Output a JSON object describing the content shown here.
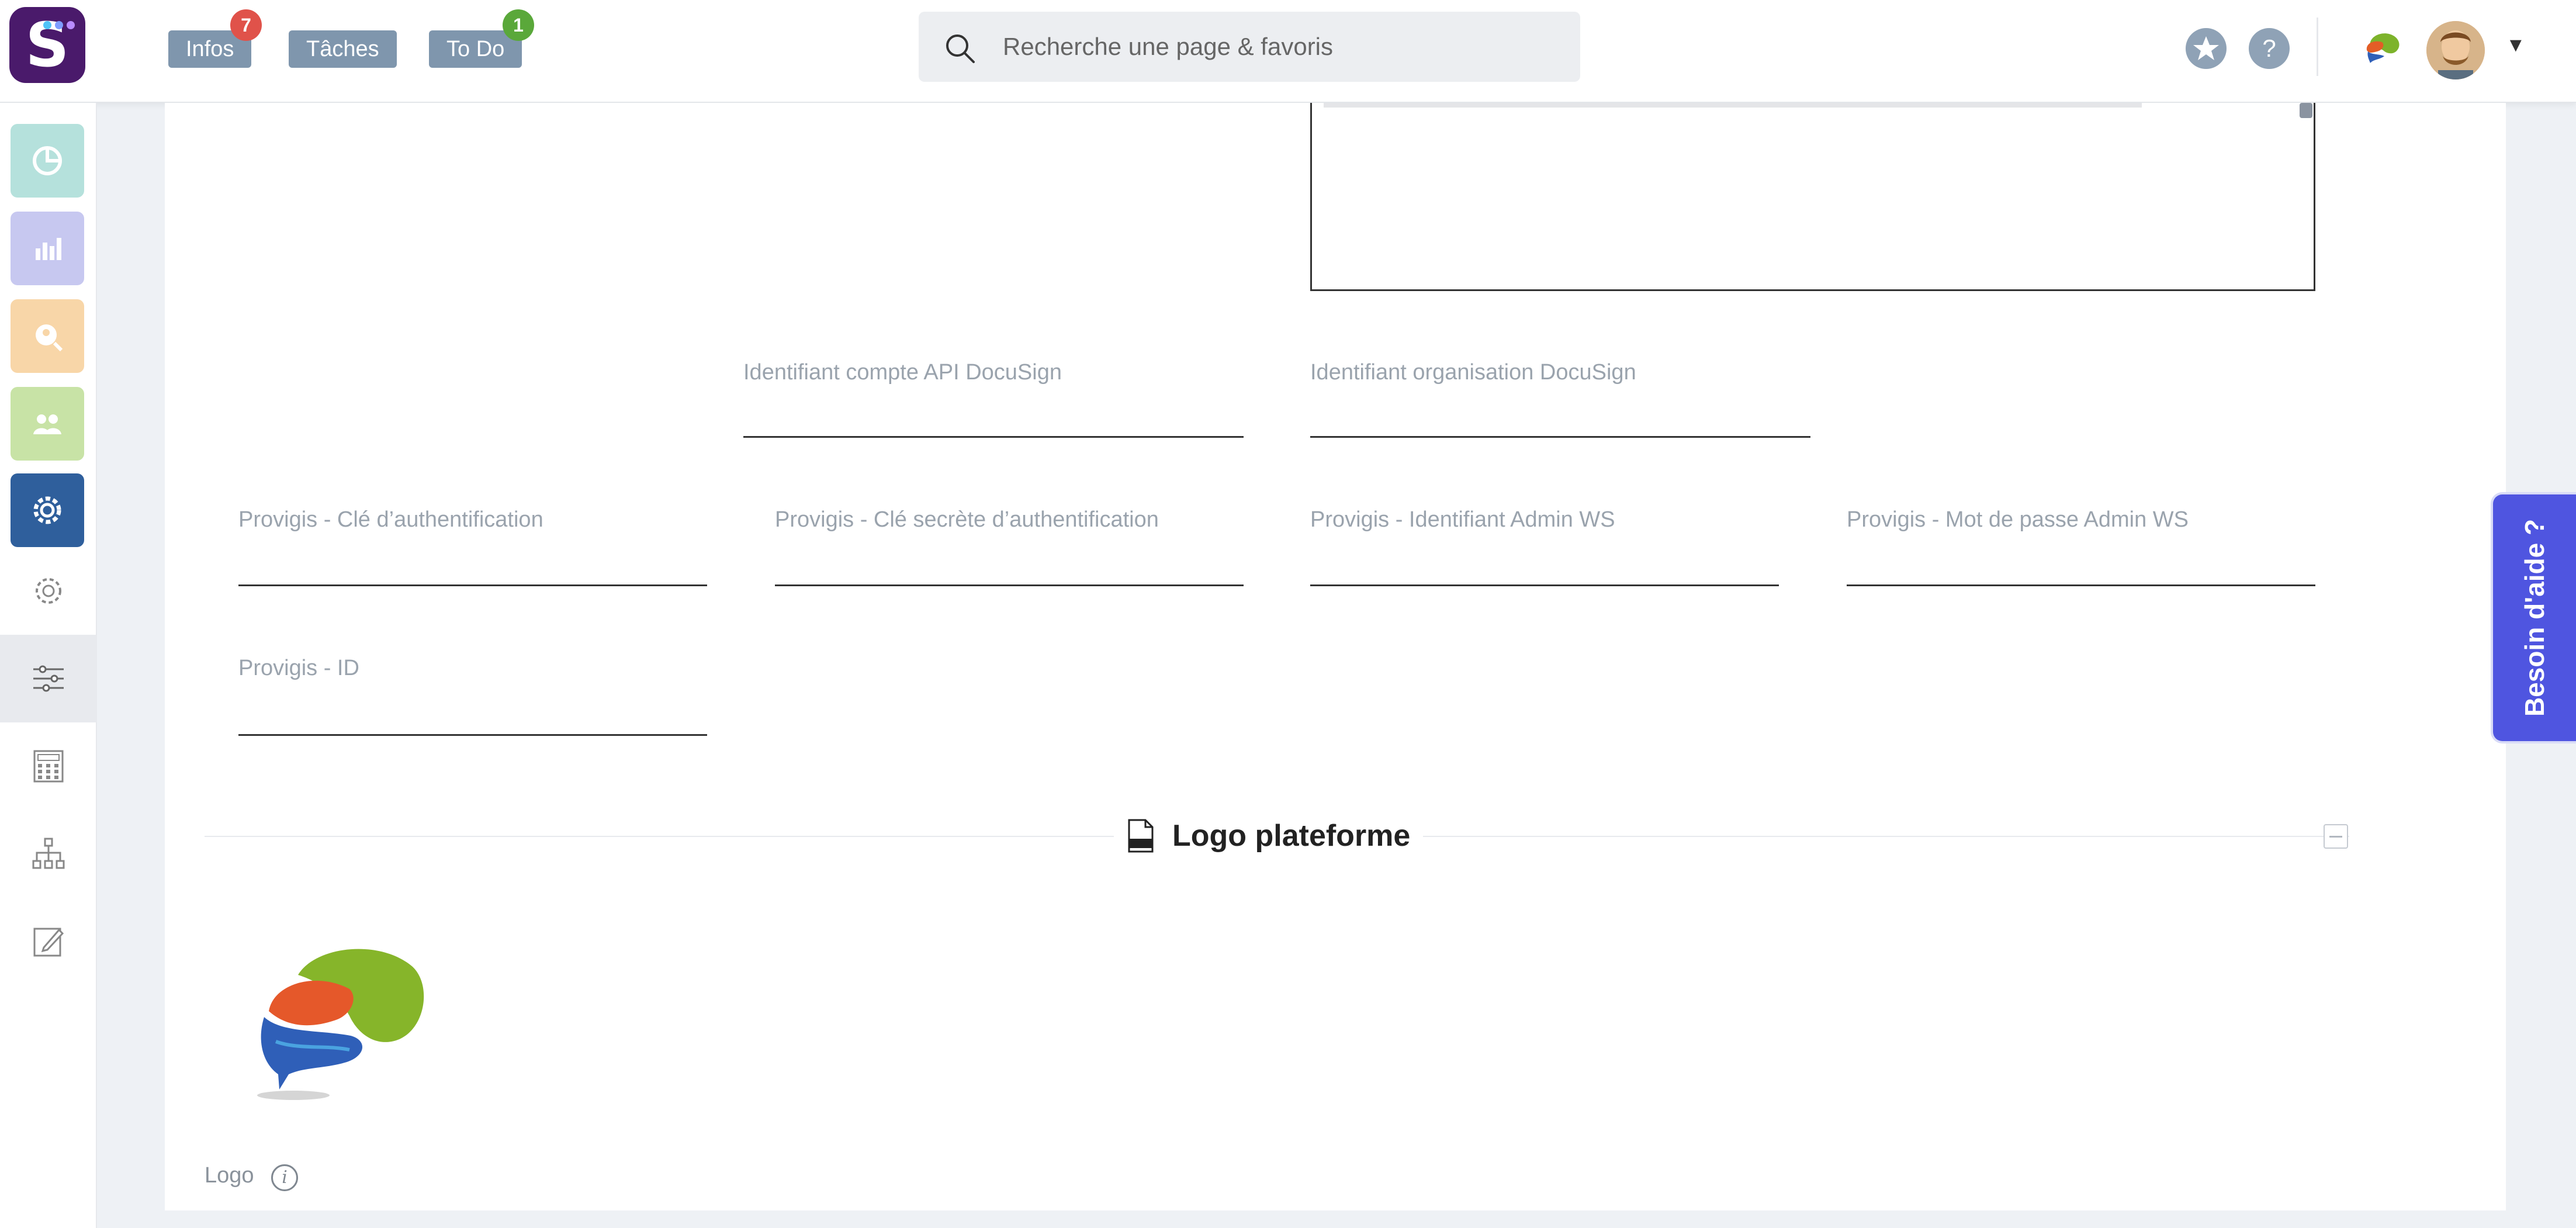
{
  "topbar": {
    "nav": [
      {
        "label": "Infos",
        "badge": "7"
      },
      {
        "label": "Tâches"
      },
      {
        "label": "To Do",
        "badge": "1"
      }
    ],
    "search_placeholder": "Recherche une page & favoris",
    "help_icon": "?"
  },
  "colors": {
    "brand": "#4a1a6b",
    "nav_button": "#7f96ad",
    "badge_red": "#e0524a",
    "badge_green": "#5aa83a",
    "help_tab": "#4f55e0"
  },
  "icons": [
    "app-logo",
    "search-icon",
    "star-icon",
    "help-icon",
    "brain-logo-icon",
    "user-avatar",
    "chevron-down-icon",
    "png-file-icon",
    "info-icon",
    "settings-icon",
    "sliders-icon",
    "calculator-icon",
    "org-chart-icon",
    "edit-icon"
  ],
  "fields": {
    "docusign_account": {
      "label": "Identifiant compte API DocuSign",
      "value": ""
    },
    "docusign_org": {
      "label": "Identifiant organisation DocuSign",
      "value": ""
    },
    "provigis_key": {
      "label": "Provigis - Clé d’authentification",
      "value": ""
    },
    "provigis_secret": {
      "label": "Provigis - Clé secrète d’authentification",
      "value": ""
    },
    "provigis_admin_id": {
      "label": "Provigis - Identifiant Admin WS",
      "value": ""
    },
    "provigis_admin_pwd": {
      "label": "Provigis - Mot de passe Admin WS",
      "value": ""
    },
    "provigis_id": {
      "label": "Provigis - ID",
      "value": ""
    }
  },
  "section": {
    "title": "Logo plateforme",
    "logo_label": "Logo",
    "info_glyph": "i"
  },
  "help": {
    "label": "Besoin d'aide ?"
  }
}
